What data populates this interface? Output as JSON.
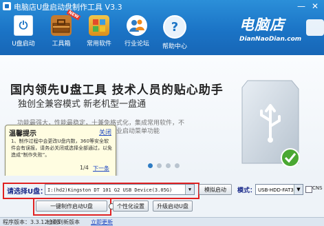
{
  "app": {
    "title": "电脑店U盘启动盘制作工具 V3.3",
    "window_buttons": {
      "minimize": "—",
      "close": "✕"
    }
  },
  "toolbar": {
    "items": [
      {
        "label": "U盘启动",
        "icon": "usb-drive-icon"
      },
      {
        "label": "工具箱",
        "icon": "toolbox-icon"
      },
      {
        "label": "常用软件",
        "icon": "software-box-icon"
      },
      {
        "label": "行业论坛",
        "icon": "forum-icon"
      },
      {
        "label": "帮助中心",
        "icon": "help-icon"
      }
    ],
    "new_badge": "NEW"
  },
  "brand": {
    "name": "电脑店",
    "url": "DianNaoDian.com"
  },
  "banner": {
    "headline": "国内领先U盘工具  技术人员的贴心助手",
    "subline": "独创全兼容模式 新老机型一盘通",
    "background_text": "功能最强大，性能最稳定，十兼免格式化，集成常用软件，不仅仅是维护，可以直接恢复，方便专业启动菜单功能",
    "dots_total": 4,
    "dots_active_index": 0
  },
  "tooltip": {
    "title": "温馨提示",
    "close": "关闭",
    "body": "1、制作过程中会更改U盘内数，360等安全软件会有误报，请务必关闭或选择全部通过，以免造成“制作失败”。",
    "page": "1/4",
    "next": "下一条"
  },
  "controls": {
    "select_label": "请选择U盘：",
    "device_value": "I:(hd2)Kingston DT 101 G2 USB Device(3.05G)",
    "simulate_button": "模拟启动",
    "mode_label": "模式：",
    "mode_value": "USB-HDD-FAT32",
    "cns_label": "CNS",
    "make_button": "一键制作启动U盘",
    "personalize_button": "个性化设置",
    "upgrade_button": "升级启动U盘"
  },
  "status_bar": {
    "version": "程序版本：3.3.12.303",
    "message": "检测到新版本",
    "link": "立即更新"
  },
  "colors": {
    "header": "#1b74c6",
    "accent_red": "#e02020",
    "link": "#1a44c2"
  }
}
